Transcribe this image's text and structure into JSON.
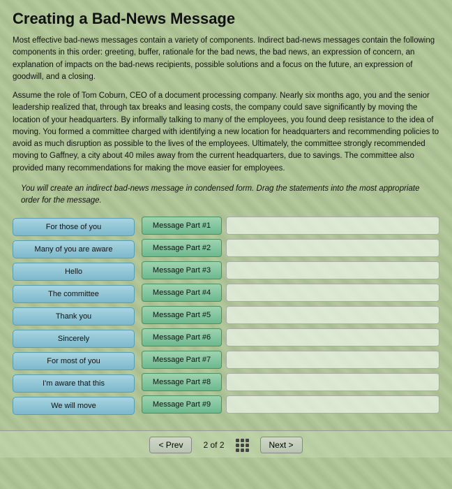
{
  "title": "Creating a Bad-News Message",
  "intro": "Most effective bad-news messages contain a variety of components. Indirect bad-news messages contain the following components in this order: greeting, buffer, rationale for the bad news, the bad news, an expression of concern, an explanation of impacts on the bad-news recipients, possible solutions and a focus on the future, an expression of goodwill, and a closing.",
  "scenario": "Assume the role of Tom Coburn, CEO of a document processing company. Nearly six months ago, you and the senior leadership realized that, through tax breaks and leasing costs, the company could save significantly by moving the location of your headquarters. By informally talking to many of the employees, you found deep resistance to the idea of moving. You formed a committee charged with identifying a new location for headquarters and recommending policies to avoid as much disruption as possible to the lives of the employees. Ultimately, the committee strongly recommended moving to Gaffney, a city about 40 miles away from the current headquarters, due to savings. The committee also provided many recommendations for making the move easier for employees.",
  "instruction": "You will create an indirect bad-news message in condensed form. Drag the statements into the most appropriate order for the message.",
  "sources": [
    "For those of you",
    "Many of you are aware",
    "Hello",
    "The committee",
    "Thank you",
    "Sincerely",
    "For most of you",
    "I'm aware that this",
    "We will move"
  ],
  "targets": [
    "Message Part #1",
    "Message Part #2",
    "Message Part #3",
    "Message Part #4",
    "Message Part #5",
    "Message Part #6",
    "Message Part #7",
    "Message Part #8",
    "Message Part #9"
  ],
  "nav": {
    "prev_label": "< Prev",
    "page_info": "2 of 2",
    "next_label": "Next >"
  }
}
